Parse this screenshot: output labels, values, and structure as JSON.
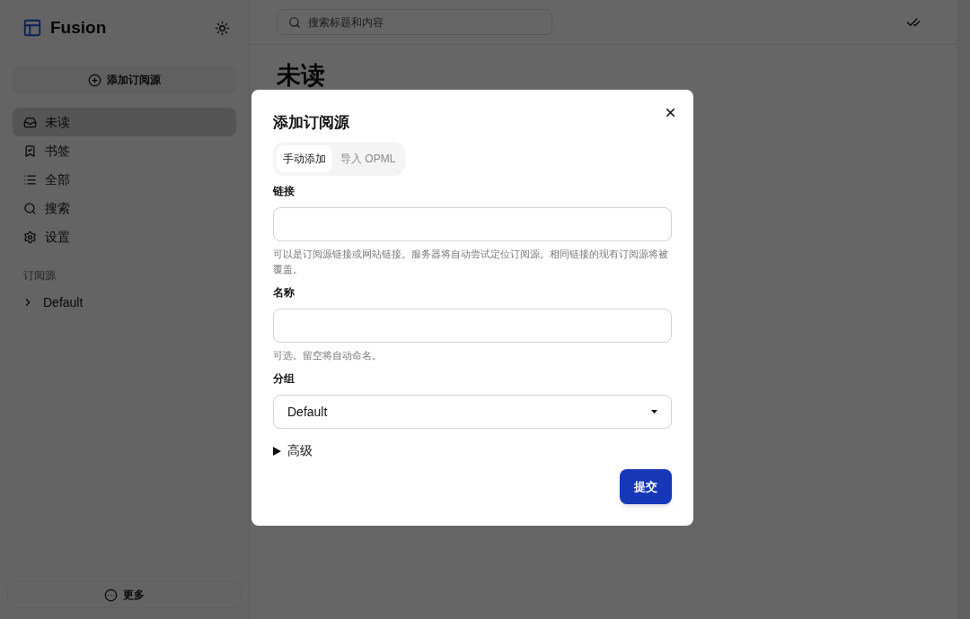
{
  "app": {
    "name": "Fusion"
  },
  "sidebar": {
    "add_button": "添加订阅源",
    "items": [
      {
        "kind": "inbox",
        "label": "未读",
        "selected": true
      },
      {
        "kind": "bookmark",
        "label": "书签",
        "selected": false
      },
      {
        "kind": "list",
        "label": "全部",
        "selected": false
      },
      {
        "kind": "search",
        "label": "搜索",
        "selected": false
      },
      {
        "kind": "settings",
        "label": "设置",
        "selected": false
      }
    ],
    "section_title": "订阅源",
    "feeds": [
      {
        "label": "Default",
        "expanded": false
      }
    ],
    "more_button": "更多"
  },
  "search": {
    "placeholder": "搜索标题和内容"
  },
  "page_title": "未读",
  "dialog": {
    "title": "添加订阅源",
    "tabs": [
      {
        "label": "手动添加",
        "selected": true
      },
      {
        "label": "导入 OPML",
        "selected": false
      }
    ],
    "fields": [
      {
        "kind": "text",
        "label": "链接",
        "help": "可以是订阅源链接或网站链接。服务器将自动尝试定位订阅源。相同链接的现有订阅源将被覆盖。"
      },
      {
        "kind": "text",
        "label": "名称",
        "help": "可选。留空将自动命名。"
      },
      {
        "kind": "select",
        "label": "分组",
        "value": "Default"
      }
    ],
    "advanced": {
      "label": "高级",
      "expanded": false
    },
    "submit": "提交"
  }
}
